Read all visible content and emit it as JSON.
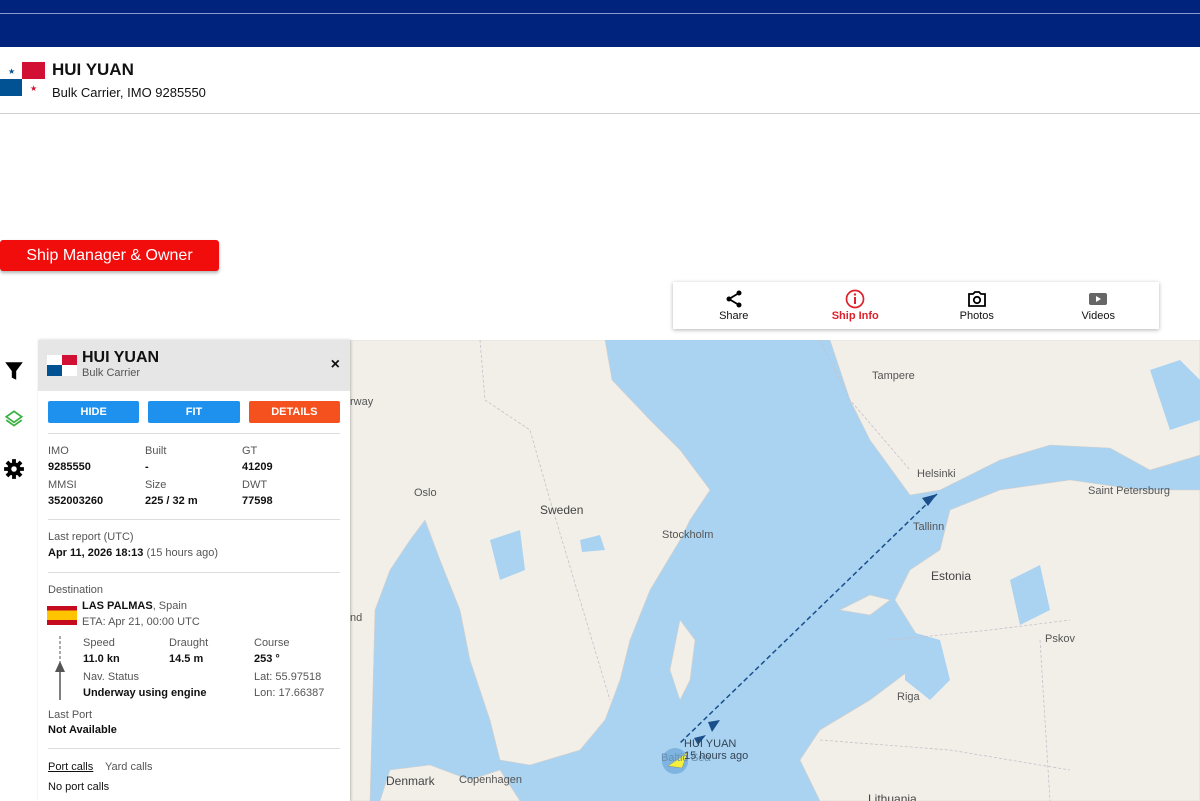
{
  "ship": {
    "name": "HUI YUAN",
    "subtitle": "Bulk Carrier, IMO 9285550",
    "type": "Bulk Carrier"
  },
  "actions": {
    "manager_owner": "Ship Manager & Owner"
  },
  "toolbar": [
    {
      "label": "Share",
      "icon": "share-icon"
    },
    {
      "label": "Ship Info",
      "icon": "info-icon",
      "active": true
    },
    {
      "label": "Photos",
      "icon": "camera-icon"
    },
    {
      "label": "Videos",
      "icon": "video-icon"
    }
  ],
  "panel": {
    "buttons": {
      "hide": "HIDE",
      "fit": "FIT",
      "details": "DETAILS"
    },
    "close": "×",
    "imo_label": "IMO",
    "imo": "9285550",
    "built_label": "Built",
    "built": "-",
    "gt_label": "GT",
    "gt": "41209",
    "mmsi_label": "MMSI",
    "mmsi": "352003260",
    "size_label": "Size",
    "size": "225 / 32 m",
    "dwt_label": "DWT",
    "dwt": "77598",
    "last_report_label": "Last report (UTC)",
    "last_report": "Apr 11, 2026 18:13",
    "last_report_ago": "(15 hours ago)",
    "destination_label": "Destination",
    "destination": "LAS PALMAS",
    "destination_country": ", Spain",
    "eta": "ETA: Apr 21, 00:00 UTC",
    "speed_label": "Speed",
    "speed": "11.0 kn",
    "draught_label": "Draught",
    "draught": "14.5 m",
    "course_label": "Course",
    "course": "253 °",
    "nav_status_label": "Nav. Status",
    "nav_status": "Underway using engine",
    "lat": "Lat: 55.97518",
    "lon": "Lon: 17.66387",
    "last_port_label": "Last Port",
    "last_port": "Not Available",
    "tabs": {
      "port_calls": "Port calls",
      "yard_calls": "Yard calls"
    },
    "no_port_calls": "No port calls"
  },
  "map": {
    "labels": {
      "norway": "rway",
      "oslo": "Oslo",
      "sweden": "Sweden",
      "stockholm": "Stockholm",
      "tampere": "Tampere",
      "helsinki": "Helsinki",
      "saint_petersburg": "Saint Petersburg",
      "tallinn": "Tallinn",
      "estonia": "Estonia",
      "pskov": "Pskov",
      "riga": "Riga",
      "denmark": "Denmark",
      "copenhagen": "Copenhagen",
      "lithuania": "Lithuania",
      "nd": "nd",
      "baltic": "Baltic Sea"
    },
    "ship_label": "HUI YUAN",
    "ship_ago": "15 hours ago"
  },
  "colors": {
    "brand": "#00247d",
    "red": "#f20d0d",
    "blue_btn": "#1e90ee",
    "orange_btn": "#f4511e",
    "water": "#aad3f1",
    "land": "#f2efe9"
  }
}
